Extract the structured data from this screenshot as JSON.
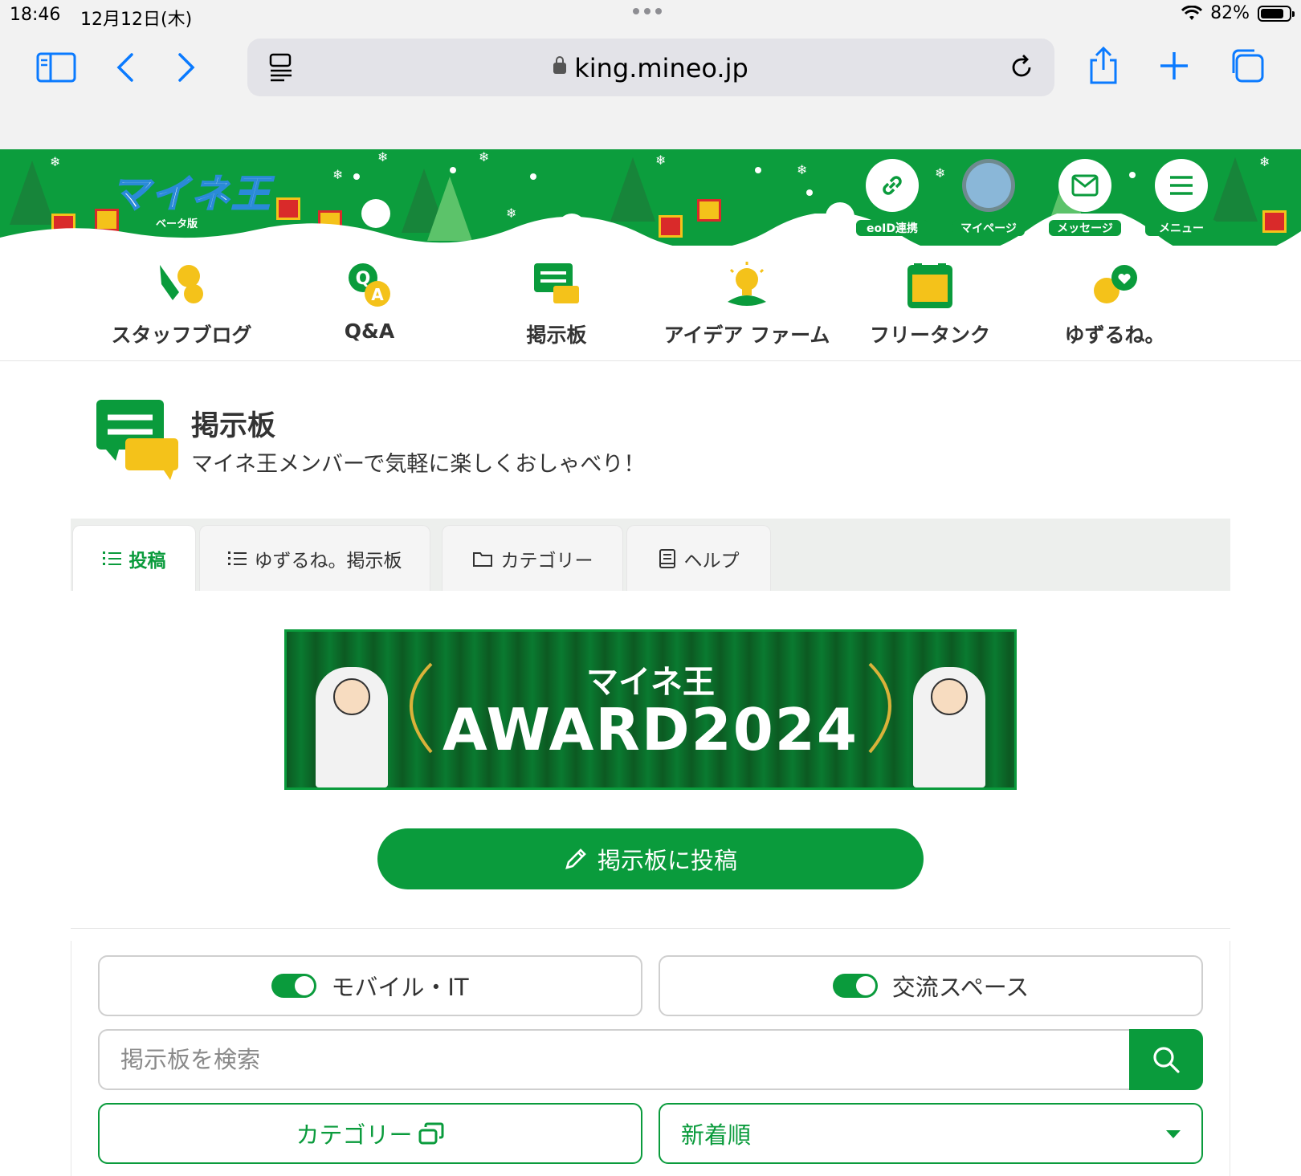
{
  "status_bar": {
    "time": "18:46",
    "date": "12月12日(木)",
    "battery": "82%",
    "battery_level": 0.82
  },
  "browser": {
    "url": "king.mineo.p",
    "url_display": "king.mineo.jp"
  },
  "site_header": {
    "logo": "マイネ王",
    "logo_sub": "ベータ版",
    "buttons": [
      {
        "icon": "link-icon",
        "label": "eoID連携"
      },
      {
        "icon": "avatar",
        "label": "マイページ"
      },
      {
        "icon": "mail-icon",
        "label": "メッセージ"
      },
      {
        "icon": "menu-icon",
        "label": "メニュー"
      }
    ]
  },
  "category_nav": [
    {
      "icon": "pen-chat-icon",
      "label": "スタッフブログ"
    },
    {
      "icon": "qa-icon",
      "label": "Q&A"
    },
    {
      "icon": "board-icon",
      "label": "掲示板"
    },
    {
      "icon": "lightbulb-icon",
      "label": "アイデア ファーム"
    },
    {
      "icon": "tank-icon",
      "label": "フリータンク"
    },
    {
      "icon": "heart-chat-icon",
      "label": "ゆずるね。"
    }
  ],
  "board": {
    "title": "掲示板",
    "subtitle": "マイネ王メンバーで気軽に楽しくおしゃべり！"
  },
  "tabs": [
    {
      "icon": "list-icon",
      "label": "投稿",
      "active": true
    },
    {
      "icon": "list-icon",
      "label": "ゆずるね。掲示板",
      "active": false
    },
    {
      "icon": "folder-icon",
      "label": "カテゴリー",
      "active": false
    },
    {
      "icon": "book-icon",
      "label": "ヘルプ",
      "active": false
    }
  ],
  "banner": {
    "line1": "マイネ王",
    "line2": "AWARD2024"
  },
  "post_button": {
    "label": "掲示板に投稿",
    "icon": "pencil-icon"
  },
  "filters": [
    {
      "label": "モバイル・IT",
      "on": true
    },
    {
      "label": "交流スペース",
      "on": true
    }
  ],
  "search": {
    "placeholder": "掲示板を検索",
    "value": ""
  },
  "category_button": {
    "label": "カテゴリー",
    "icon": "window-stack-icon"
  },
  "sort": {
    "selected": "新着順"
  },
  "colors": {
    "accent": "#0a9b3c",
    "header_bg": "#0c9d3d",
    "ios_blue": "#0a7aff",
    "tab_strip": "#edefed"
  }
}
